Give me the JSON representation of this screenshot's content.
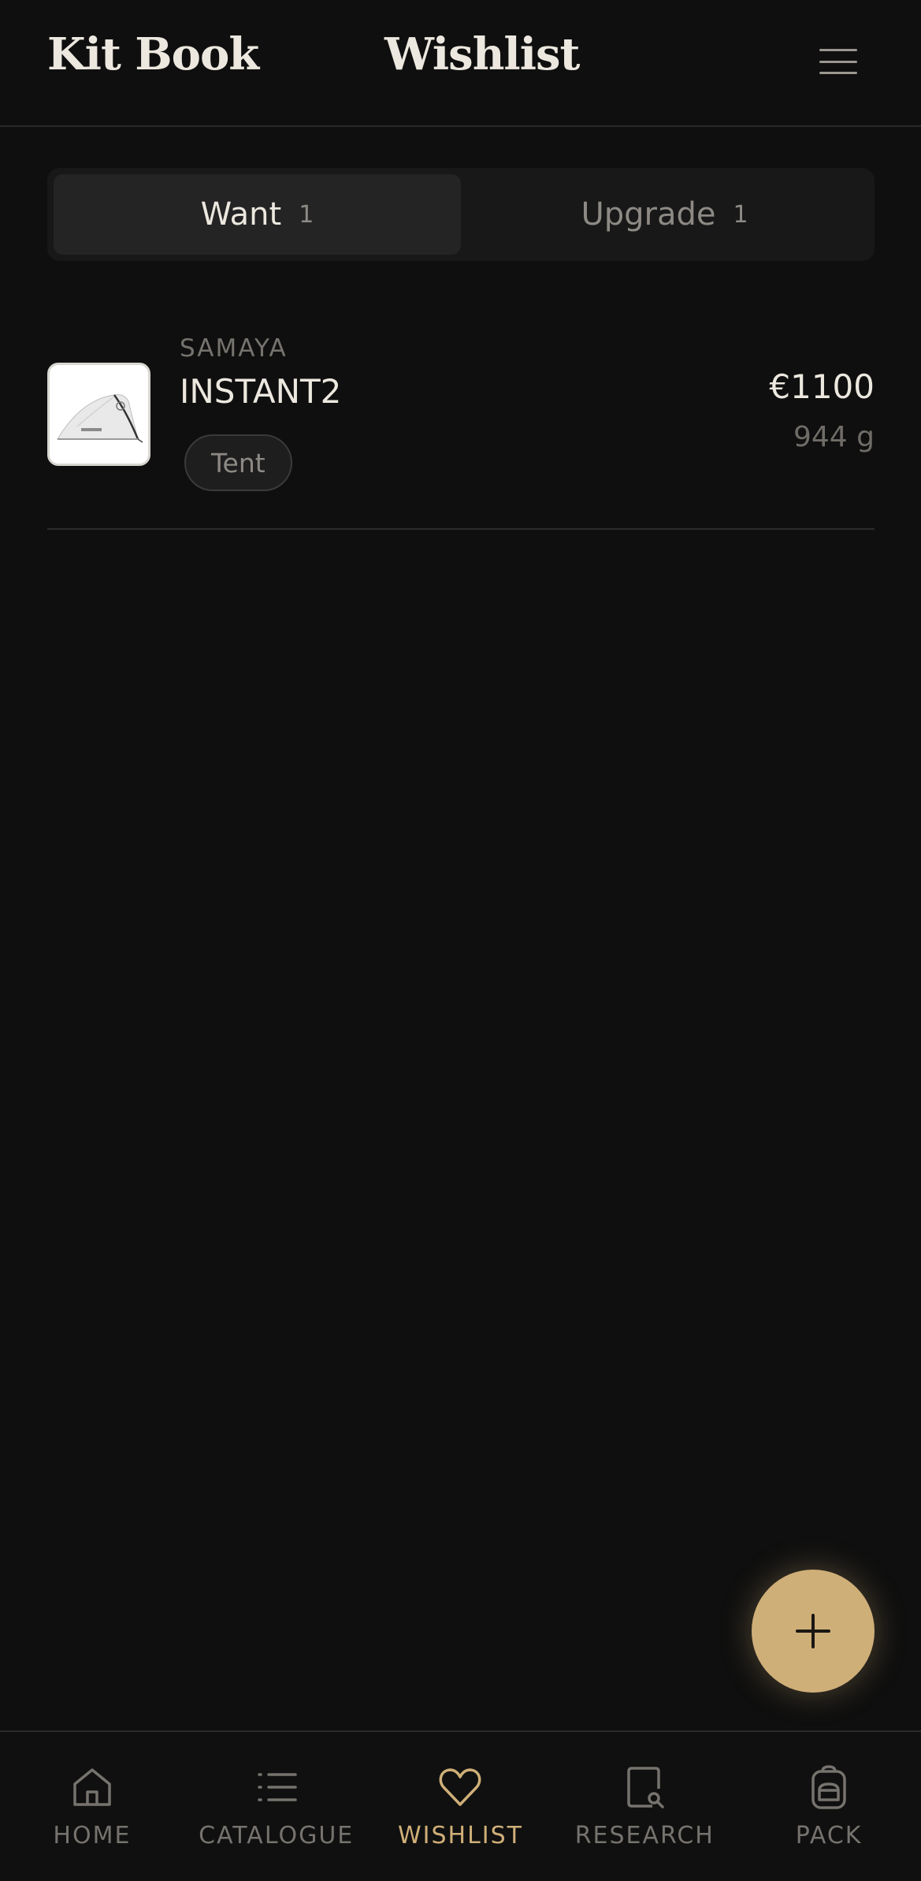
{
  "header": {
    "brand": "Kit Book",
    "title": "Wishlist",
    "menu_icon": "hamburger-menu-icon"
  },
  "tabs": [
    {
      "label": "Want",
      "count": "1",
      "active": true
    },
    {
      "label": "Upgrade",
      "count": "1",
      "active": false
    }
  ],
  "items": [
    {
      "brand": "SAMAYA",
      "name": "INSTANT2",
      "category": "Tent",
      "price": "€1100",
      "weight": "944 g",
      "thumbnail_icon": "tent-image"
    }
  ],
  "fab": {
    "icon": "plus-icon"
  },
  "nav": [
    {
      "label": "HOME",
      "icon": "home-icon",
      "active": false
    },
    {
      "label": "CATALOGUE",
      "icon": "list-icon",
      "active": false
    },
    {
      "label": "WISHLIST",
      "icon": "heart-icon",
      "active": true
    },
    {
      "label": "RESEARCH",
      "icon": "research-icon",
      "active": false
    },
    {
      "label": "PACK",
      "icon": "backpack-icon",
      "active": false
    }
  ],
  "colors": {
    "background": "#0f0f0f",
    "accent": "#cfaf78",
    "text": "#ece8df",
    "muted": "#76736e"
  }
}
